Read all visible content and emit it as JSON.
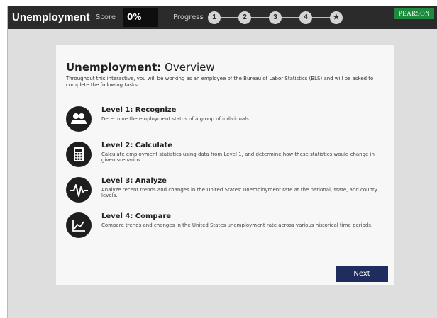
{
  "header": {
    "app_title": "Unemployment",
    "score_label": "Score",
    "score_value": "0%",
    "progress_label": "Progress",
    "progress_steps": [
      "1",
      "2",
      "3",
      "4",
      "★"
    ],
    "logo_text": "PEARSON"
  },
  "overview": {
    "title_strong": "Unemployment:",
    "title_rest": "Overview",
    "intro": "Throughout this interactive, you will be working as an employee of the Bureau of Labor Statistics (BLS) and will be asked to complete the following tasks:",
    "levels": [
      {
        "title": "Level 1: Recognize",
        "description": "Determine the employment status of a group of individuals.",
        "icon": "people-icon"
      },
      {
        "title": "Level 2: Calculate",
        "description": "Calculate employment statistics using data from Level 1, and determine how these statistics would change in given scenarios.",
        "icon": "calculator-icon"
      },
      {
        "title": "Level 3: Analyze",
        "description": "Analyze recent trends and changes in the United States' unemployment rate at the national, state, and county levels.",
        "icon": "pulse-icon"
      },
      {
        "title": "Level 4: Compare",
        "description": "Compare trends and changes in the United States unemployment rate across various historical time periods.",
        "icon": "line-chart-icon"
      }
    ],
    "next_label": "Next"
  },
  "colors": {
    "topbar": "#2b2b2b",
    "next_button": "#1f2c5e",
    "logo": "#1e8a3e"
  }
}
